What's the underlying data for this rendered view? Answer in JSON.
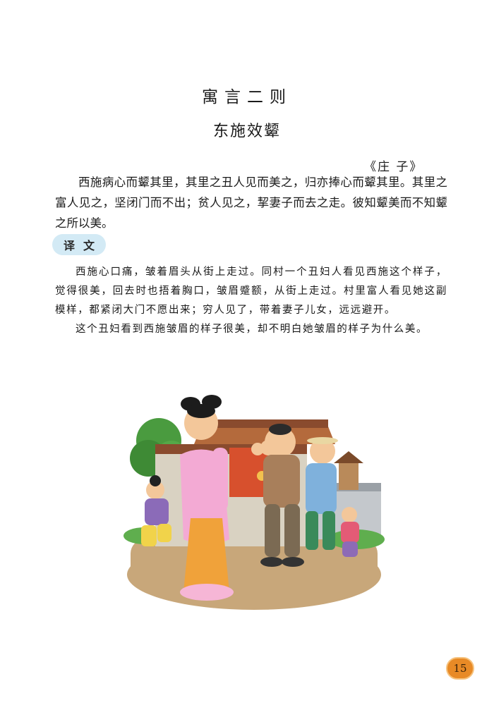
{
  "heading": {
    "title": "寓言二则",
    "subtitle": "东施效颦",
    "source": "《庄 子》"
  },
  "original_text": "西施病心而颦其里，其里之丑人见而美之，归亦捧心而颦其里。其里之富人见之，坚闭门而不出；贫人见之，挈妻子而去之走。彼知颦美而不知颦之所以美。",
  "translation": {
    "label": "译文",
    "paragraphs": [
      "西施心口痛，皱着眉头从街上走过。同村一个丑妇人看见西施这个样子，觉得很美，回去时也捂着胸口，皱眉蹙额，从街上走过。村里富人看见她这副模样，都紧闭大门不愿出来；穷人见了，带着妻子儿女，远远避开。",
      "这个丑妇看到西施皱眉的样子很美，却不明白她皱眉的样子为什么美。"
    ]
  },
  "page_number": "15"
}
